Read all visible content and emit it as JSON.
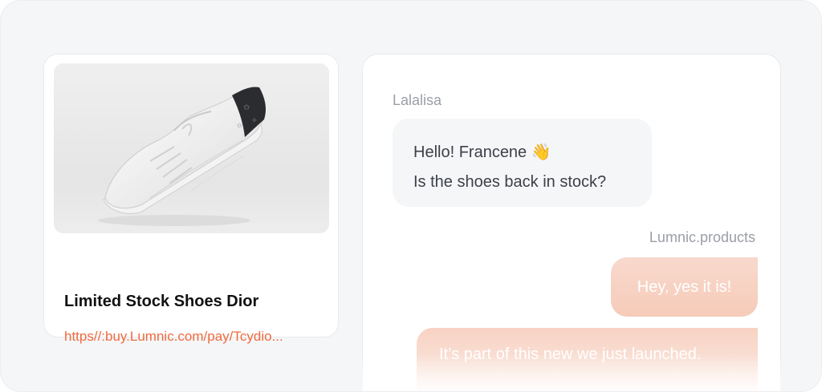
{
  "product": {
    "image": "white-sneaker-with-black-star-heel",
    "title": "Limited Stock Shoes Dior",
    "link": "https//:buy.Lumnic.com/pay/Tcydio..."
  },
  "chat": {
    "messages": [
      {
        "sender": "Lalalisa",
        "direction": "incoming",
        "lines": [
          "Hello! Francene 👋",
          "Is the shoes back in stock?"
        ]
      },
      {
        "sender": "Lumnic.products",
        "direction": "outgoing",
        "lines": [
          "Hey, yes it is!"
        ]
      },
      {
        "direction": "outgoing",
        "lines": [
          "It’s part of this new we just launched."
        ]
      }
    ]
  },
  "colors": {
    "accent": "#ee6b3f",
    "outgoing_bubble": "#f6cbb9",
    "incoming_bubble": "#f5f6f8",
    "background": "#f5f6f8"
  }
}
